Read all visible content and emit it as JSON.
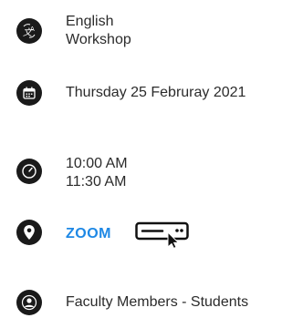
{
  "event": {
    "title_lines": [
      "English",
      "Workshop"
    ],
    "date": "Thursday 25 Februray 2021",
    "time_lines": [
      "10:00 AM",
      "11:30 AM"
    ],
    "location_link": "ZOOM",
    "audience": "Faculty Members - Students"
  },
  "icons": {
    "title": "translate-icon",
    "date": "calendar-icon",
    "time": "clock-icon",
    "location": "location-pin-icon",
    "join": "join-online-icon",
    "audience": "user-icon"
  },
  "colors": {
    "icon_bg": "#1a1a1a",
    "text": "#2b2b2b",
    "link": "#1e88e5"
  }
}
